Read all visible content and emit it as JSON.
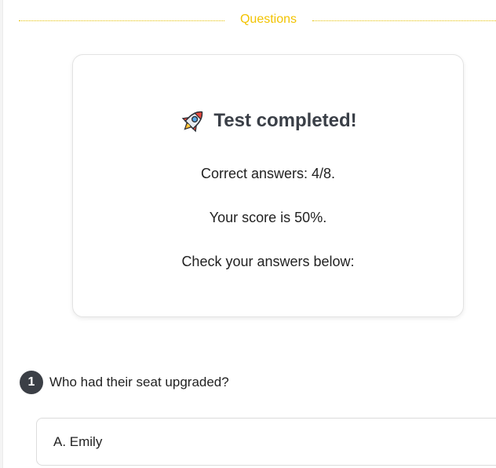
{
  "section": {
    "title": "Questions"
  },
  "result": {
    "title": "Test completed!",
    "correct_answers": "Correct answers: 4/8.",
    "score": "Your score is 50%.",
    "check": "Check your answers below:",
    "icon": "rocket-icon"
  },
  "question": {
    "number": "1",
    "text": "Who had their seat upgraded?",
    "options": [
      {
        "label": "A. Emily"
      }
    ]
  },
  "colors": {
    "accent": "#f2c300",
    "badge": "#3b3f46",
    "title": "#3a3f47"
  }
}
